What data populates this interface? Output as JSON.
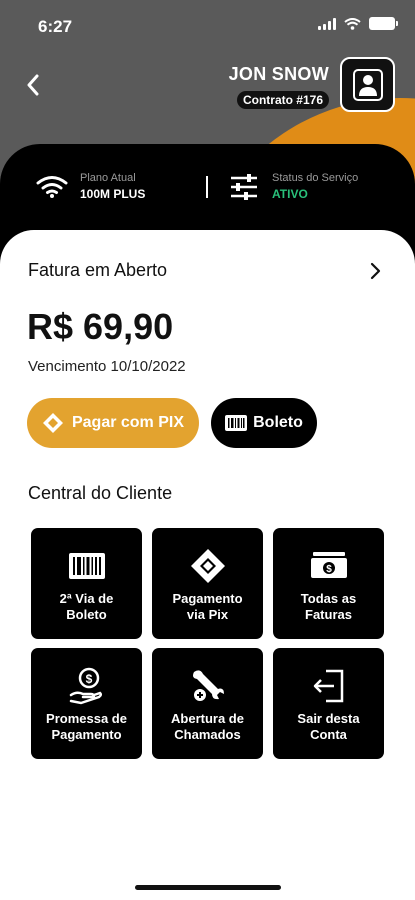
{
  "status_bar": {
    "time": "6:27"
  },
  "header": {
    "user_name": "JON SNOW",
    "contract": "Contrato #176"
  },
  "service_info": {
    "plan_label": "Plano Atual",
    "plan_value": "100M PLUS",
    "status_label": "Status do Serviço",
    "status_value": "ATIVO",
    "status_color": "#29c07a"
  },
  "invoice": {
    "title": "Fatura em Aberto",
    "amount": "R$ 69,90",
    "due": "Vencimento 10/10/2022",
    "pix_button": "Pagar com PIX",
    "boleto_button": "Boleto"
  },
  "central": {
    "title": "Central do Cliente",
    "tiles": [
      {
        "icon": "barcode-icon",
        "label": "2ª Via de\nBoleto"
      },
      {
        "icon": "pix-icon",
        "label": "Pagamento\nvia Pix"
      },
      {
        "icon": "money-icon",
        "label": "Todas as\nFaturas"
      },
      {
        "icon": "coin-hand-icon",
        "label": "Promessa de\nPagamento"
      },
      {
        "icon": "tools-icon",
        "label": "Abertura de\nChamados"
      },
      {
        "icon": "exit-icon",
        "label": "Sair desta\nConta"
      }
    ]
  },
  "colors": {
    "accent": "#e08c17",
    "pix_button": "#e3a32f",
    "header_gray": "#5a5a5a"
  }
}
